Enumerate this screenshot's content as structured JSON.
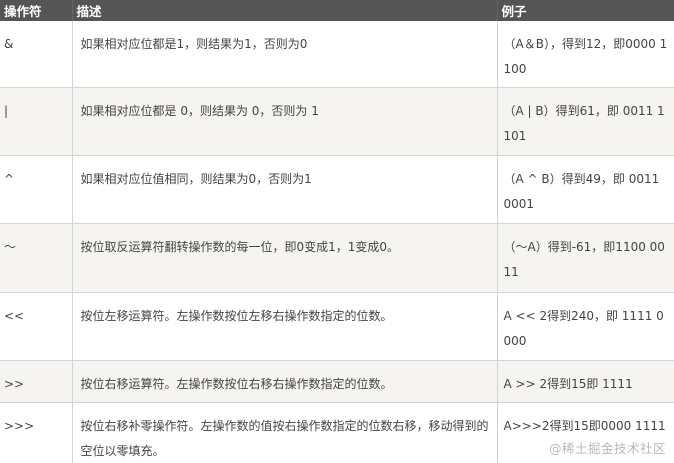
{
  "table": {
    "headers": [
      "操作符",
      "描述",
      "例子"
    ],
    "rows": [
      {
        "op": "&",
        "desc": "如果相对应位都是1，则结果为1，否则为0",
        "example": "（A＆B），得到12，即0000 1100"
      },
      {
        "op": "|",
        "desc": "如果相对应位都是 0，则结果为 0，否则为 1",
        "example": "（A | B）得到61，即 0011 1101"
      },
      {
        "op": "^",
        "desc": "如果相对应位值相同，则结果为0，否则为1",
        "example": "（A ^ B）得到49，即 0011 0001"
      },
      {
        "op": "〜",
        "desc": "按位取反运算符翻转操作数的每一位，即0变成1，1变成0。",
        "example": "（〜A）得到-61，即1100 0011"
      },
      {
        "op": "<<",
        "desc": "按位左移运算符。左操作数按位左移右操作数指定的位数。",
        "example": "A << 2得到240，即 1111 0000"
      },
      {
        "op": ">>",
        "desc": "按位右移运算符。左操作数按位右移右操作数指定的位数。",
        "example": "A >> 2得到15即 1111"
      },
      {
        "op": ">>>",
        "desc": "按位右移补零操作符。左操作数的值按右操作数指定的位数右移，移动得到的空位以零填充。",
        "example": "A>>>2得到15即0000 1111"
      }
    ]
  },
  "watermark": "@稀土掘金技术社区"
}
